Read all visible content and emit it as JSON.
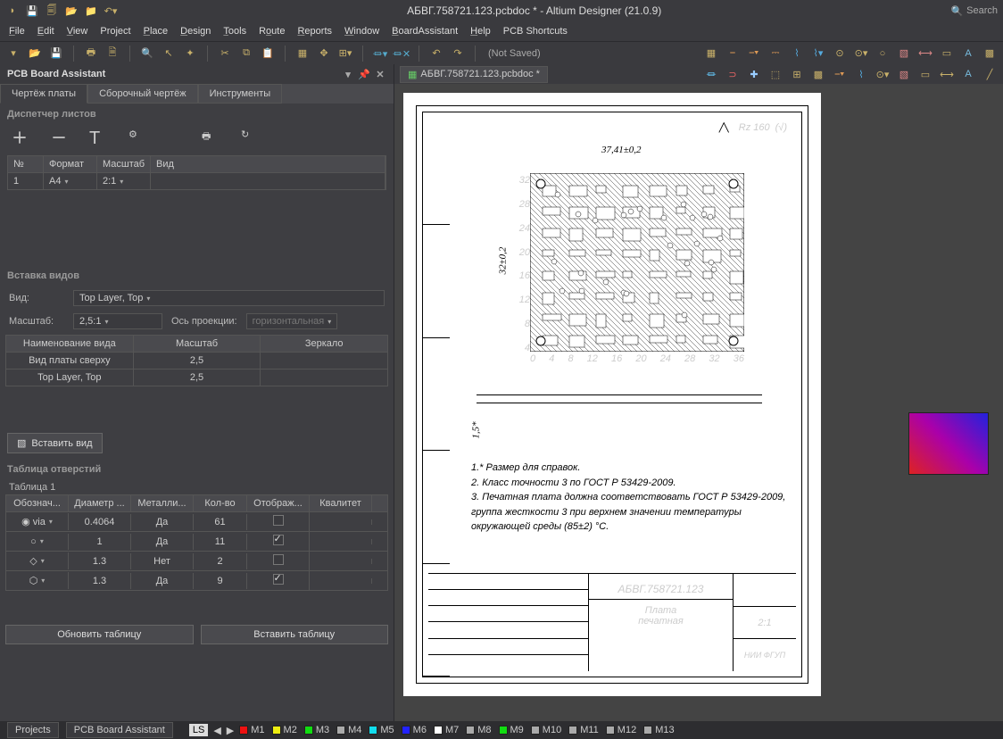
{
  "title": "АБВГ.758721.123.pcbdoc * - Altium Designer (21.0.9)",
  "search": "Search",
  "menu": [
    "File",
    "Edit",
    "View",
    "Project",
    "Place",
    "Design",
    "Tools",
    "Route",
    "Reports",
    "Window",
    "BoardAssistant",
    "Help",
    "PCB Shortcuts"
  ],
  "notSaved": "(Not Saved)",
  "panel": {
    "title": "PCB Board Assistant",
    "tabs": [
      "Чертёж платы",
      "Сборочный чертёж",
      "Инструменты"
    ],
    "activeTab": 0,
    "sheets": {
      "title": "Диспетчер листов",
      "cols": [
        "№",
        "Формат",
        "Масштаб",
        "Вид"
      ],
      "row": {
        "no": "1",
        "fmt": "A4",
        "scl": "2:1",
        "view": ""
      }
    },
    "insert": {
      "title": "Вставка видов",
      "viewLabel": "Вид:",
      "viewValue": "Top Layer, Top",
      "scaleLabel": "Масштаб:",
      "scaleValue": "2,5:1",
      "axisLabel": "Ось проекции:",
      "axisValue": "горизонтальная",
      "hdr": [
        "Наименование вида",
        "Масштаб",
        "Зеркало"
      ],
      "rows": [
        {
          "name": "Вид платы сверху",
          "scale": "2,5",
          "mirror": ""
        },
        {
          "name": "Top Layer, Top",
          "scale": "2,5",
          "mirror": ""
        }
      ],
      "button": "Вставить вид"
    },
    "holes": {
      "title": "Таблица отверстий",
      "tableName": "Таблица 1",
      "cols": [
        "Обознач...",
        "Диаметр ...",
        "Металли...",
        "Кол-во",
        "Отображ...",
        "Квалитет"
      ],
      "rows": [
        {
          "sym": "via",
          "dia": "0.4064",
          "met": "Да",
          "cnt": "61",
          "show": false,
          "q": ""
        },
        {
          "sym": "circ",
          "dia": "1",
          "met": "Да",
          "cnt": "11",
          "show": true,
          "q": ""
        },
        {
          "sym": "diam",
          "dia": "1.3",
          "met": "Нет",
          "cnt": "2",
          "show": false,
          "q": ""
        },
        {
          "sym": "hex",
          "dia": "1.3",
          "met": "Да",
          "cnt": "9",
          "show": true,
          "q": ""
        }
      ],
      "btnUpdate": "Обновить таблицу",
      "btnInsert": "Вставить таблицу"
    }
  },
  "docTab": "АБВГ.758721.123.pcbdoc *",
  "drawing": {
    "rz": "Rz 160",
    "dimTop": "37,41±0,2",
    "dimLeft": "32±0,2",
    "dimSide": "1,5*",
    "rulerX": [
      "0",
      "4",
      "8",
      "12",
      "16",
      "20",
      "24",
      "28",
      "32",
      "36"
    ],
    "rulerY": [
      "32",
      "28",
      "24",
      "20",
      "16",
      "12",
      "8",
      "4"
    ],
    "notes": [
      "1.* Размер для справок.",
      "2. Класс точности 3 по ГОСТ Р 53429-2009.",
      "3. Печатная плата должна соответствовать ГОСТ Р 53429-2009, группа жесткости 3 при верхнем значении температуры окружающей среды (85±2) °С."
    ],
    "tb": {
      "code": "АБВГ.758721.123",
      "name1": "Плата",
      "name2": "печатная",
      "scale": "2:1",
      "org": "НИИ ФГУП"
    }
  },
  "status": {
    "tabs": [
      "Projects",
      "PCB Board Assistant"
    ],
    "ls": "LS",
    "layers": [
      {
        "n": "M1",
        "c": "#e11"
      },
      {
        "n": "M2",
        "c": "#ee1"
      },
      {
        "n": "M3",
        "c": "#1d1"
      },
      {
        "n": "M4",
        "c": "#aaa"
      },
      {
        "n": "M5",
        "c": "#1de"
      },
      {
        "n": "M6",
        "c": "#22f"
      },
      {
        "n": "M7",
        "c": "#fff"
      },
      {
        "n": "M8",
        "c": "#aaa"
      },
      {
        "n": "M9",
        "c": "#1d1"
      },
      {
        "n": "M10",
        "c": "#aaa"
      },
      {
        "n": "M11",
        "c": "#aaa"
      },
      {
        "n": "M12",
        "c": "#aaa"
      },
      {
        "n": "M13",
        "c": "#aaa"
      }
    ]
  }
}
